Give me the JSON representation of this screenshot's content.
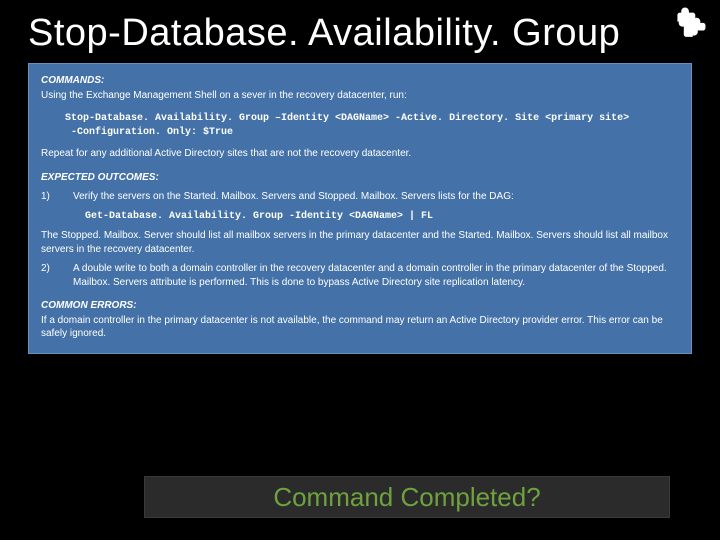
{
  "title": "Stop-Database. Availability. Group",
  "panel": {
    "commands_head": "COMMANDS:",
    "commands_intro": "Using the Exchange Management Shell on a sever in the recovery datacenter, run:",
    "commands_code": "Stop-Database. Availability. Group –Identity <DAGName> -Active. Directory. Site <primary site>\n -Configuration. Only: $True",
    "commands_repeat": "Repeat for any additional Active Directory sites that are not the recovery datacenter.",
    "expected_head": "EXPECTED OUTCOMES:",
    "expected_item1_num": "1)",
    "expected_item1_text": "Verify the servers on the Started. Mailbox. Servers and Stopped. Mailbox. Servers lists for the DAG:",
    "expected_item1_code": "Get-Database. Availability. Group -Identity <DAGName> | FL",
    "expected_item1_after": "The Stopped. Mailbox. Server should list all mailbox servers in the primary datacenter and the Started. Mailbox. Servers should list all mailbox servers in the recovery datacenter.",
    "expected_item2_num": "2)",
    "expected_item2_text": "A double write to both a domain controller in the recovery datacenter and a domain controller in the primary datacenter of the Stopped. Mailbox. Servers attribute is performed.  This is done to bypass Active Directory site replication latency.",
    "errors_head": "COMMON ERRORS:",
    "errors_text": "If a domain controller in the primary datacenter is not available, the command may return an Active Directory provider error.  This error can be safely ignored."
  },
  "footer": "Command Completed?"
}
